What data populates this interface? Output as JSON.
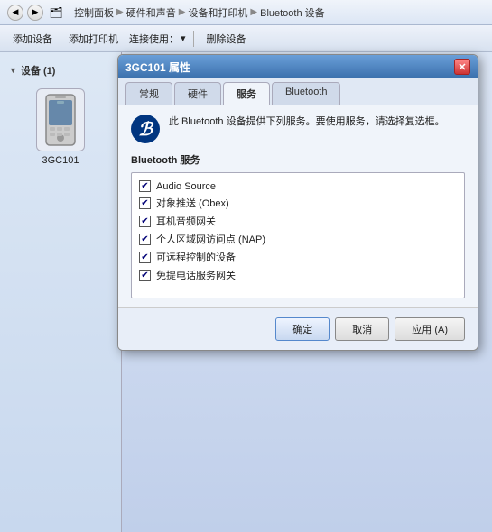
{
  "addressbar": {
    "breadcrumbs": [
      "控制面板",
      "硬件和声音",
      "设备和打印机",
      "Bluetooth 设备"
    ]
  },
  "toolbar": {
    "add_device": "添加设备",
    "add_printer": "添加打印机",
    "connect_use": "连接使用：",
    "delete_device": "删除设备"
  },
  "left_panel": {
    "section_label": "设备 (1)",
    "device_name": "3GC101"
  },
  "dialog": {
    "title": "3GC101 属性",
    "close_label": "✕",
    "tabs": [
      {
        "label": "常规"
      },
      {
        "label": "硬件"
      },
      {
        "label": "服务",
        "active": true
      },
      {
        "label": "Bluetooth"
      }
    ],
    "description": "此 Bluetooth 设备提供下列服务。要使用服务，请选择复选框。",
    "bt_symbol": "ℬ",
    "services_label": "Bluetooth 服务",
    "services": [
      {
        "label": "Audio Source",
        "checked": true
      },
      {
        "label": "对象推送 (Obex)",
        "checked": true
      },
      {
        "label": "耳机音频网关",
        "checked": true
      },
      {
        "label": "个人区域网访问点 (NAP)",
        "checked": true
      },
      {
        "label": "可远程控制的设备",
        "checked": true
      },
      {
        "label": "免提电话服务网关",
        "checked": true
      }
    ],
    "buttons": {
      "ok": "确定",
      "cancel": "取消",
      "apply": "应用 (A)"
    }
  }
}
